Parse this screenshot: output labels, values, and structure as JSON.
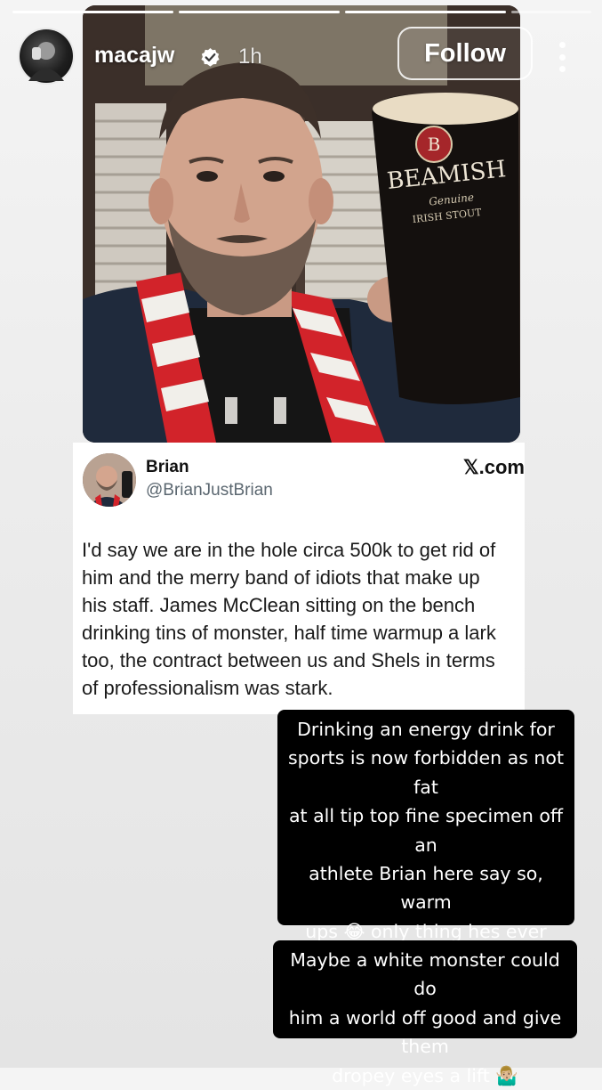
{
  "story": {
    "progress_segments": 4,
    "progress_done": 3,
    "username": "macajw",
    "verified": true,
    "time_ago": "1h",
    "follow_label": "Follow",
    "more_icon": "more-vertical-icon",
    "photo_text": {
      "can_brand": "BEAMISH",
      "can_sub": "Genuine",
      "can_type": "IRISH STOUT"
    }
  },
  "tweet": {
    "name": "Brian",
    "handle": "@BrianJustBrian",
    "source": "𝕏.com",
    "body": "I'd say we are in the hole circa 500k to get rid of\nhim and the merry band of idiots that make up\nhis staff. James McClean sitting on the bench\ndrinking tins of monster, half time warmup a lark\ntoo, the contract between us and Shels in terms\nof professionalism was stark."
  },
  "captions": [
    {
      "text": "Drinking an energy drink for\nsports is now forbidden as not fat\nat all tip top fine specimen off an\nathlete Brian here say so, warm\nups 😂 only thing hes ever\nwarmed up is food in the\nmircowave the meatball"
    },
    {
      "text": "Maybe a white monster could do\nhim a world off good and give them\ndropey eyes a lift 🤷🏼‍♂️"
    }
  ],
  "colors": {
    "caption_bg": "#000000",
    "caption_text": "#ffffff",
    "verified_blue": "#ffffff",
    "scarf_red": "#d2232a"
  }
}
